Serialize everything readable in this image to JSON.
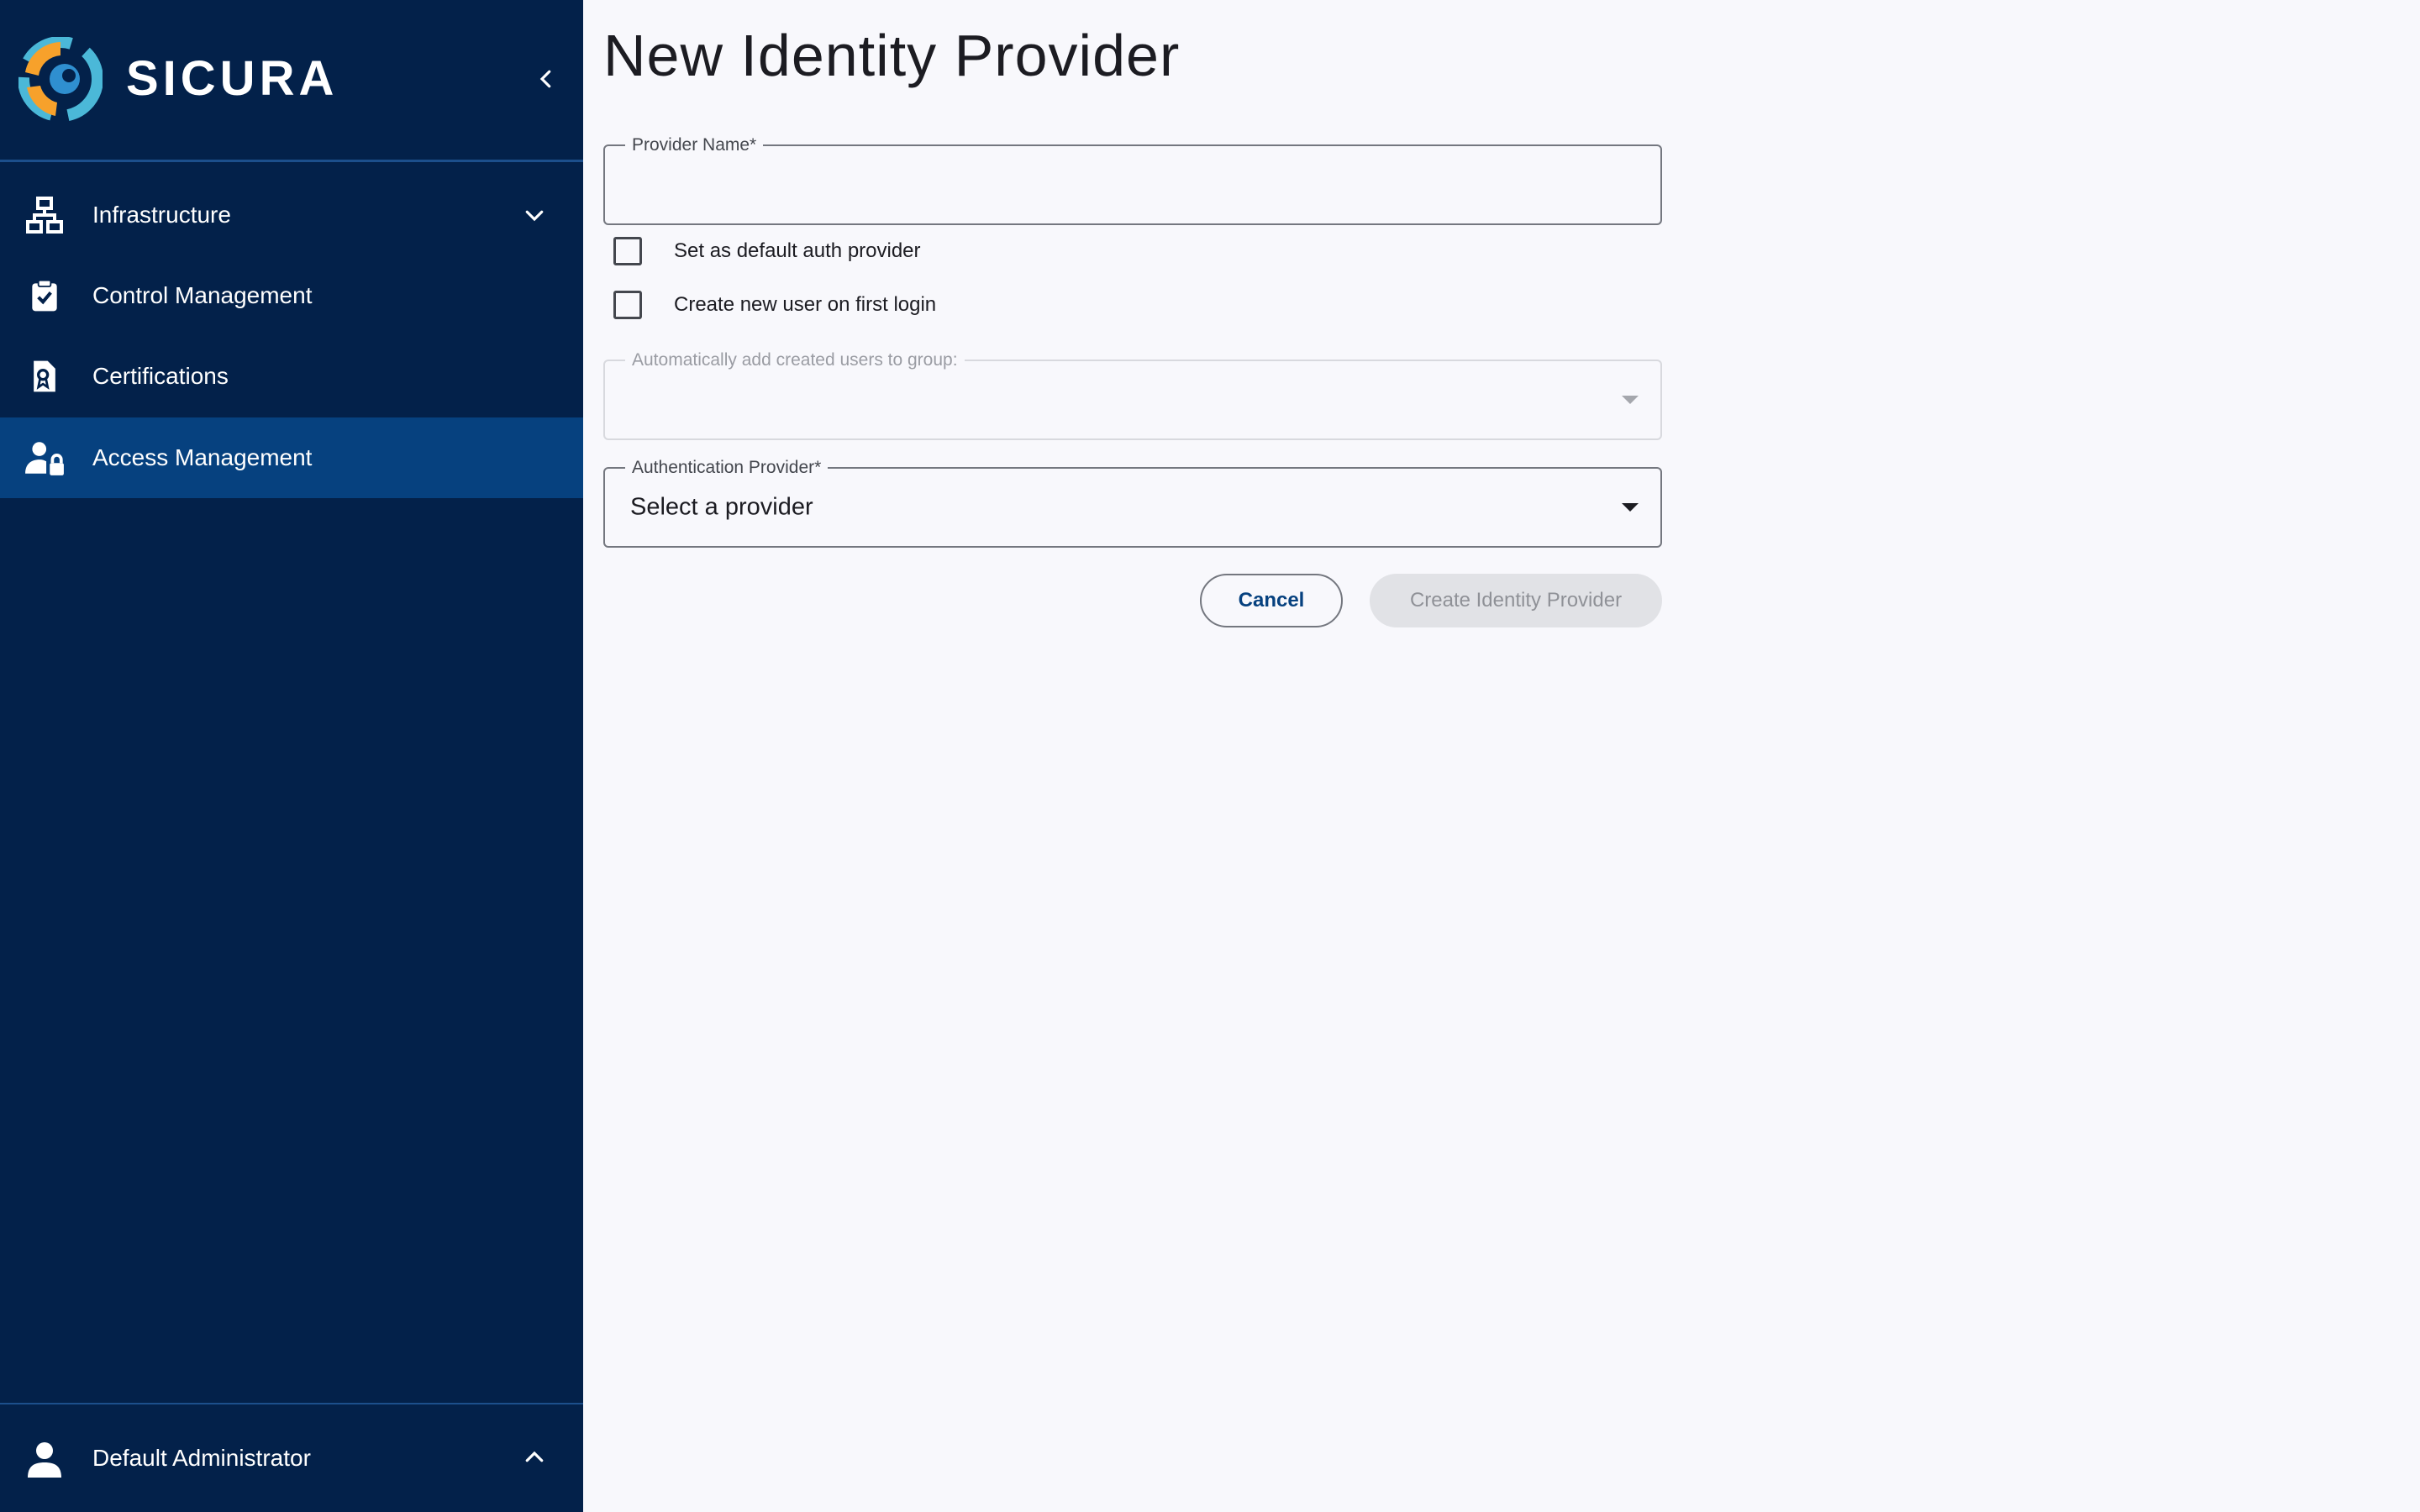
{
  "brand": {
    "name": "SICURA",
    "colors": {
      "sidebar": "#03214a",
      "sidebar_active": "#06417f",
      "accent_orange": "#f7a12b",
      "accent_teal": "#4bb8d8"
    }
  },
  "sidebar": {
    "collapse_icon": "chevron-left-icon",
    "items": [
      {
        "label": "Infrastructure",
        "icon": "network-icon",
        "expandable": true
      },
      {
        "label": "Control Management",
        "icon": "clipboard-check-icon"
      },
      {
        "label": "Certifications",
        "icon": "certificate-icon"
      },
      {
        "label": "Access Management",
        "icon": "user-lock-icon",
        "active": true
      }
    ],
    "user": {
      "label": "Default Administrator",
      "icon": "user-icon"
    }
  },
  "form": {
    "title": "New Identity Provider",
    "provider_name": {
      "label": "Provider Name*",
      "value": ""
    },
    "default_auth": {
      "label": "Set as default auth provider",
      "checked": false
    },
    "create_user": {
      "label": "Create new user on first login",
      "checked": false
    },
    "group": {
      "label": "Automatically add created users to group:",
      "value": "",
      "disabled": true
    },
    "auth_provider": {
      "label": "Authentication Provider*",
      "value": "Select a provider"
    },
    "cancel_label": "Cancel",
    "submit_label": "Create Identity Provider"
  }
}
